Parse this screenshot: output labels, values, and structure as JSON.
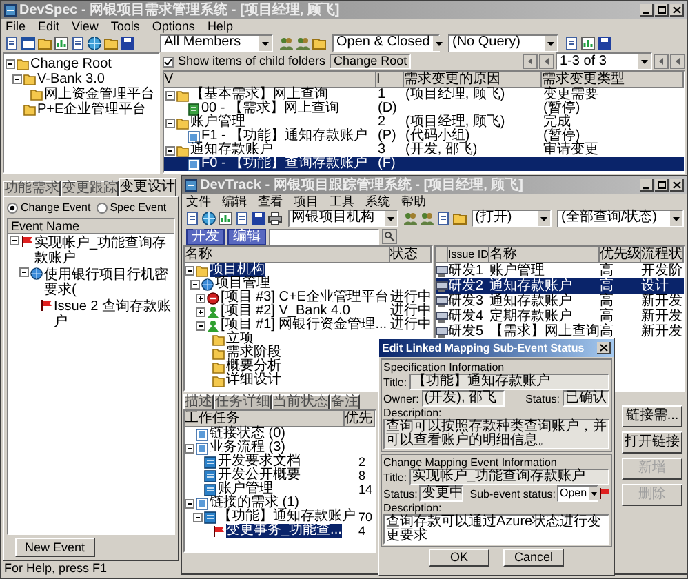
{
  "main_window": {
    "title": "DevSpec - 网银项目需求管理系统 - [项目经理, 顾飞]",
    "active": false,
    "menu": [
      "File",
      "Edit",
      "View",
      "Tools",
      "Options",
      "Help"
    ],
    "toolbar": {
      "member_filter": "All Members",
      "status_filter": "Open & Closed",
      "query_filter": "(No Query)"
    },
    "folder_tree": [
      {
        "label": "Change Root",
        "kind": "folder",
        "expanded": true,
        "children": [
          {
            "label": "V-Bank 3.0",
            "kind": "folder",
            "expanded": true,
            "children": [
              {
                "label": "网上资金管理平台",
                "kind": "folder"
              }
            ]
          },
          {
            "label": "P+E企业管理平台",
            "kind": "folder"
          }
        ]
      }
    ],
    "show_child_items": {
      "label": "Show items of child folders",
      "checked": true
    },
    "root_label": "Change Root",
    "pager": "1-3 of 3",
    "table": {
      "columns": [
        "V",
        "I",
        "需求变更的原因",
        "需求变更类型"
      ],
      "rows": [
        {
          "name": "【基本需求】网上查询",
          "number": "1",
          "reason": "(项目经理, 顾飞)",
          "type": "变更需要",
          "kind": "folder",
          "expanded": true,
          "selected": false,
          "children": [
            {
              "name": "00 - 【需求】网上查询",
              "number": "(D)",
              "type": "(暂停)",
              "kind": "document",
              "selected": false
            }
          ]
        },
        {
          "name": "账户管理",
          "number": "2",
          "reason": "(项目经理, 顾飞)",
          "type": "完成",
          "kind": "folder",
          "expanded": true,
          "selected": false,
          "children": [
            {
              "name": "F1 - 【功能】通知存款账户",
              "number": "(P)",
              "reason": "(代码小组)",
              "type": "(暂停)",
              "kind": "form",
              "selected": false
            }
          ]
        },
        {
          "name": "通知存款账户",
          "number": "3",
          "reason": "(开发, 邵飞)",
          "type": "审请变更",
          "kind": "folder",
          "expanded": true,
          "selected": false,
          "children": [
            {
              "name": "F0 - 【功能】查询存款账户",
              "number": "(F)",
              "kind": "form",
              "selected": true
            }
          ]
        }
      ]
    },
    "left_panel": {
      "tabs": [
        {
          "label": "功能需求",
          "selected": false
        },
        {
          "label": "变更跟踪",
          "selected": false
        },
        {
          "label": "变更设计",
          "selected": true
        }
      ],
      "event_types": [
        {
          "label": "Change Event",
          "selected": true
        },
        {
          "label": "Spec Event",
          "selected": false
        }
      ],
      "event_list": {
        "header": "Event Name",
        "items": [
          {
            "label": "实现帐户_功能查询存款账户",
            "kind": "flag",
            "expanded": true,
            "children": [
              {
                "label": "使用银行项目行机密要求(",
                "kind": "globe",
                "expanded": true,
                "children": [
                  {
                    "label": "Issue 2 查询存款账户",
                    "kind": "flag"
                  }
                ]
              }
            ]
          }
        ]
      },
      "new_event_button": "New Event"
    },
    "status_bar": "For Help, press F1"
  },
  "devtrack_window": {
    "title": "DevTrack - 网银项目跟踪管理系统 - [项目经理, 顾飞]",
    "active": false,
    "menu": [
      "文件",
      "编辑",
      "查看",
      "项目",
      "工具",
      "系统",
      "帮助"
    ],
    "toolbar": {
      "project_filter": "网银项目机构",
      "state_filter": "(打开)",
      "query_filter": "(全部查询/状态)"
    },
    "action_buttons": [
      "开发",
      "编辑"
    ],
    "project_tree": {
      "columns": [
        "名称",
        "状态"
      ],
      "items": [
        {
          "label": "项目机构",
          "kind": "folder",
          "expanded": true,
          "selected": true,
          "children": [
            {
              "label": "项目管理",
              "kind": "globe",
              "expanded": true,
              "selected": false,
              "children": [
                {
                  "label": "[项目 #3] C+E企业管理平台",
                  "status": "进行中",
                  "kind": "stop",
                  "expanded": false,
                  "selected": false
                },
                {
                  "label": "[项目 #2] V_Bank 4.0",
                  "status": "进行中",
                  "kind": "person",
                  "expanded": false,
                  "selected": false
                },
                {
                  "label": "[项目 #1] 网银行资金管理...",
                  "status": "进行中",
                  "kind": "person",
                  "expanded": true,
                  "selected": false,
                  "children": [
                    {
                      "label": "立项",
                      "kind": "folder",
                      "selected": false
                    },
                    {
                      "label": "需求阶段",
                      "kind": "folder",
                      "selected": false
                    },
                    {
                      "label": "概要分析",
                      "kind": "folder",
                      "selected": false
                    },
                    {
                      "label": "详细设计",
                      "kind": "folder",
                      "selected": false
                    }
                  ]
                }
              ]
            }
          ]
        }
      ]
    },
    "issue_list": {
      "columns": [
        "Issue ID",
        "名称",
        "优先级",
        "流程状"
      ],
      "rows": [
        {
          "id": "研发1",
          "name": "账户管理",
          "priority": "高",
          "state": "开发阶",
          "selected": false
        },
        {
          "id": "研发2",
          "name": "通知存款账户",
          "priority": "高",
          "state": "设计",
          "selected": true
        },
        {
          "id": "研发3",
          "name": "通知存款账户",
          "priority": "高",
          "state": "新开发",
          "selected": false
        },
        {
          "id": "研发4",
          "name": "定期存款账户",
          "priority": "高",
          "state": "新开发",
          "selected": false
        },
        {
          "id": "研发5",
          "name": "【需求】网上查询",
          "priority": "高",
          "state": "新开发",
          "selected": false
        }
      ]
    },
    "detail_tabs": [
      {
        "label": "描述",
        "selected": false
      },
      {
        "label": "任务详细",
        "selected": false
      },
      {
        "label": "当前状态",
        "selected": false
      },
      {
        "label": "备注",
        "selected": false
      }
    ],
    "task_tree": {
      "columns": [
        "工作任务",
        "优先"
      ],
      "items": [
        {
          "label": "链接状态 (0)",
          "kind": "form",
          "selected": false
        },
        {
          "label": "业务流程 (3)",
          "kind": "form",
          "expanded": true,
          "selected": false,
          "children": [
            {
              "label": "开发要求文档",
              "count": "2",
              "kind": "task",
              "selected": false
            },
            {
              "label": "开发公开概要",
              "count": "8",
              "kind": "task",
              "selected": false
            },
            {
              "label": "账户管理",
              "count": "14",
              "kind": "task",
              "selected": false
            }
          ]
        },
        {
          "label": "链接的需求 (1)",
          "kind": "form",
          "expanded": true,
          "selected": false,
          "children": [
            {
              "label": "【功能】通知存款账户",
              "count": "70",
              "kind": "task",
              "expanded": true,
              "selected": false,
              "children": [
                {
                  "label": "变更事务_功能查...",
                  "count": "4",
                  "kind": "flag",
                  "selected": true
                }
              ]
            }
          ]
        }
      ]
    },
    "side_buttons": [
      {
        "label": "链接需...",
        "disabled": false
      },
      {
        "label": "打开链接",
        "disabled": false
      },
      {
        "label": "新增",
        "disabled": true
      },
      {
        "label": "删除",
        "disabled": true
      }
    ]
  },
  "dialog": {
    "title": "Edit Linked Mapping Sub-Event Status",
    "active": true,
    "spec": {
      "legend": "Specification Information",
      "title_label": "Title:",
      "title": "【功能】通知存款账户",
      "owner_label": "Owner:",
      "owner": "(开发), 邵飞",
      "status_label": "Status:",
      "status": "已确认",
      "description_label": "Description:",
      "description": "查询可以按照存款种类查询账户，并可以查看账户的明细信息。"
    },
    "change": {
      "legend": "Change Mapping Event Information",
      "title_label": "Title:",
      "title": "实现帐户_功能查询存款账户",
      "status_label": "Status:",
      "status": "变更中",
      "sub_status_label": "Sub-event status:",
      "sub_status": "Open",
      "description_label": "Description:",
      "description": "查询存款可以通过Azure状态进行变更要求"
    },
    "buttons": [
      "OK",
      "Cancel"
    ]
  }
}
